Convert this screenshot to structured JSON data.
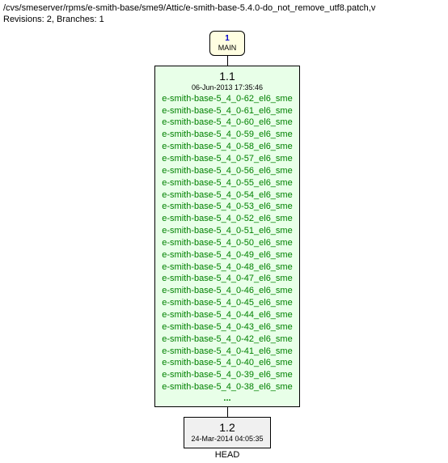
{
  "header": {
    "path": "/cvs/smeserver/rpms/e-smith-base/sme9/Attic/e-smith-base-5.4.0-do_not_remove_utf8.patch,v",
    "stats": "Revisions: 2, Branches: 1"
  },
  "main_branch": {
    "num": "1",
    "label": "MAIN"
  },
  "rev_1_1": {
    "version": "1.1",
    "date": "06-Jun-2013 17:35:46",
    "tags": [
      "e-smith-base-5_4_0-62_el6_sme",
      "e-smith-base-5_4_0-61_el6_sme",
      "e-smith-base-5_4_0-60_el6_sme",
      "e-smith-base-5_4_0-59_el6_sme",
      "e-smith-base-5_4_0-58_el6_sme",
      "e-smith-base-5_4_0-57_el6_sme",
      "e-smith-base-5_4_0-56_el6_sme",
      "e-smith-base-5_4_0-55_el6_sme",
      "e-smith-base-5_4_0-54_el6_sme",
      "e-smith-base-5_4_0-53_el6_sme",
      "e-smith-base-5_4_0-52_el6_sme",
      "e-smith-base-5_4_0-51_el6_sme",
      "e-smith-base-5_4_0-50_el6_sme",
      "e-smith-base-5_4_0-49_el6_sme",
      "e-smith-base-5_4_0-48_el6_sme",
      "e-smith-base-5_4_0-47_el6_sme",
      "e-smith-base-5_4_0-46_el6_sme",
      "e-smith-base-5_4_0-45_el6_sme",
      "e-smith-base-5_4_0-44_el6_sme",
      "e-smith-base-5_4_0-43_el6_sme",
      "e-smith-base-5_4_0-42_el6_sme",
      "e-smith-base-5_4_0-41_el6_sme",
      "e-smith-base-5_4_0-40_el6_sme",
      "e-smith-base-5_4_0-39_el6_sme",
      "e-smith-base-5_4_0-38_el6_sme"
    ],
    "ellipsis": "..."
  },
  "rev_1_2": {
    "version": "1.2",
    "date": "24-Mar-2014 04:05:35",
    "head": "HEAD"
  }
}
